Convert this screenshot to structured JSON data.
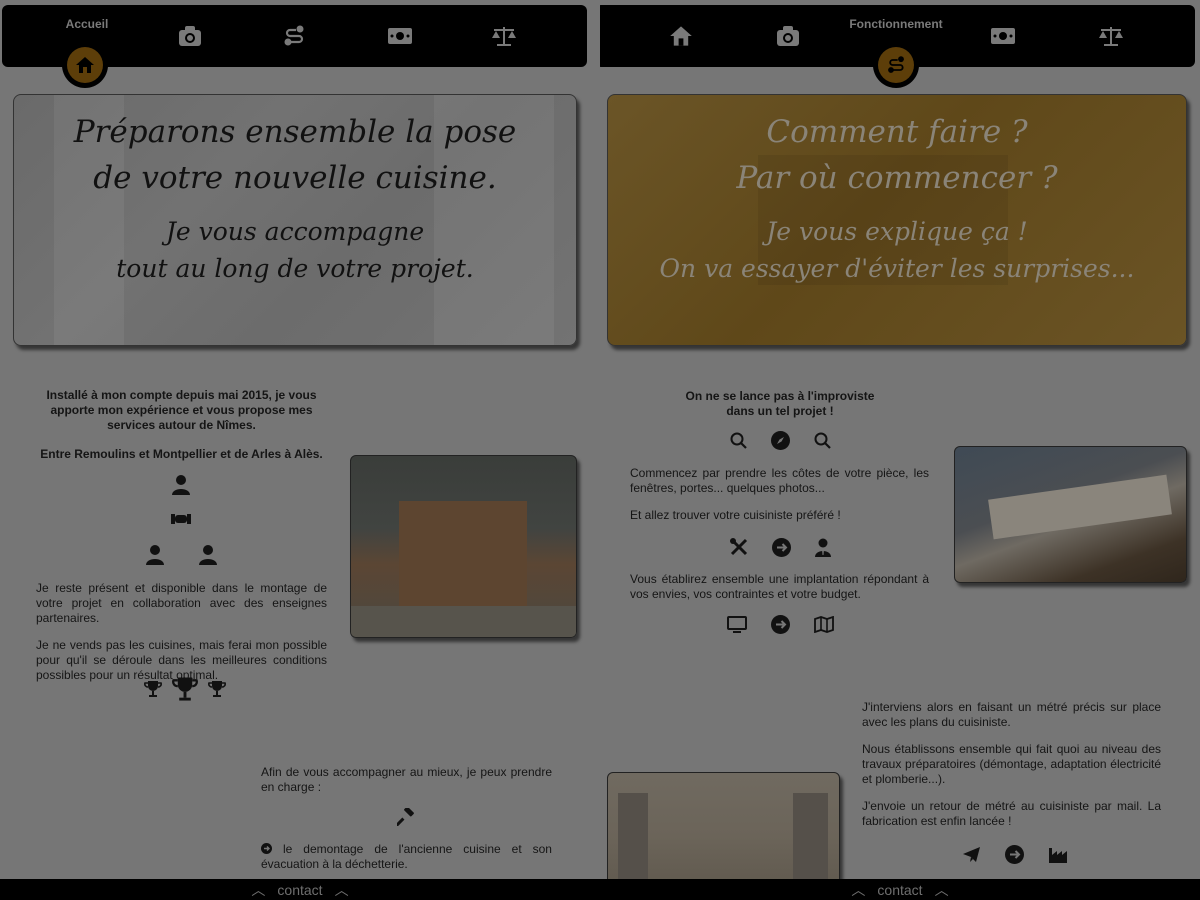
{
  "left": {
    "nav": {
      "active_label": "Accueil",
      "items": [
        "home-icon",
        "camera-icon",
        "route-icon",
        "money-icon",
        "scales-icon"
      ]
    },
    "hero": {
      "line1": "Préparons ensemble la pose",
      "line2": "de votre nouvelle cuisine.",
      "line3": "Je vous accompagne",
      "line4": "tout au long de votre projet."
    },
    "intro": "Installé à mon compte depuis mai 2015, je vous apporte mon expérience et vous propose mes services autour de Nîmes.",
    "area": "Entre Remoulins et Montpellier et de Arles à Alès.",
    "para1": "Je reste présent et disponible dans le montage de votre projet en collaboration avec des enseignes partenaires.",
    "para2": "Je ne vends pas les cuisines, mais ferai mon possible pour qu'il se déroule dans les meilleures conditions possibles pour un résultat optimal.",
    "para3": "Afin de vous accompagner au mieux, je peux prendre en charge :",
    "bullet1": "le demontage de l'ancienne cuisine et son évacuation à la déchetterie.",
    "footer_label": "contact"
  },
  "right": {
    "nav": {
      "active_label": "Fonctionnement",
      "items": [
        "home-icon",
        "camera-icon",
        "route-icon",
        "money-icon",
        "scales-icon"
      ]
    },
    "hero": {
      "line1": "Comment faire ?",
      "line2": "Par où commencer ?",
      "line3": "Je vous explique ça !",
      "line4": "On va essayer d'éviter les surprises..."
    },
    "heading": "On ne se lance pas à l'improviste dans un tel projet !",
    "step1": "Commencez par prendre les côtes de votre pièce, les fenêtres, portes... quelques photos...",
    "step2": "Et allez trouver votre cuisiniste préféré !",
    "step3": "Vous établirez ensemble une implantation répondant à vos envies, vos contraintes et votre budget.",
    "step4": "J'interviens alors en faisant un métré précis sur place avec les plans du cuisiniste.",
    "step5": "Nous établissons ensemble qui fait quoi au niveau des travaux préparatoires (démontage, adaptation électricité et plomberie...).",
    "step6": "J'envoie un retour de métré au cuisiniste par mail. La fabrication est enfin lancée !",
    "footer_label": "contact"
  },
  "colors": {
    "accent": "#5d3e09",
    "overlay": "#767676",
    "navbar": "#000000"
  }
}
